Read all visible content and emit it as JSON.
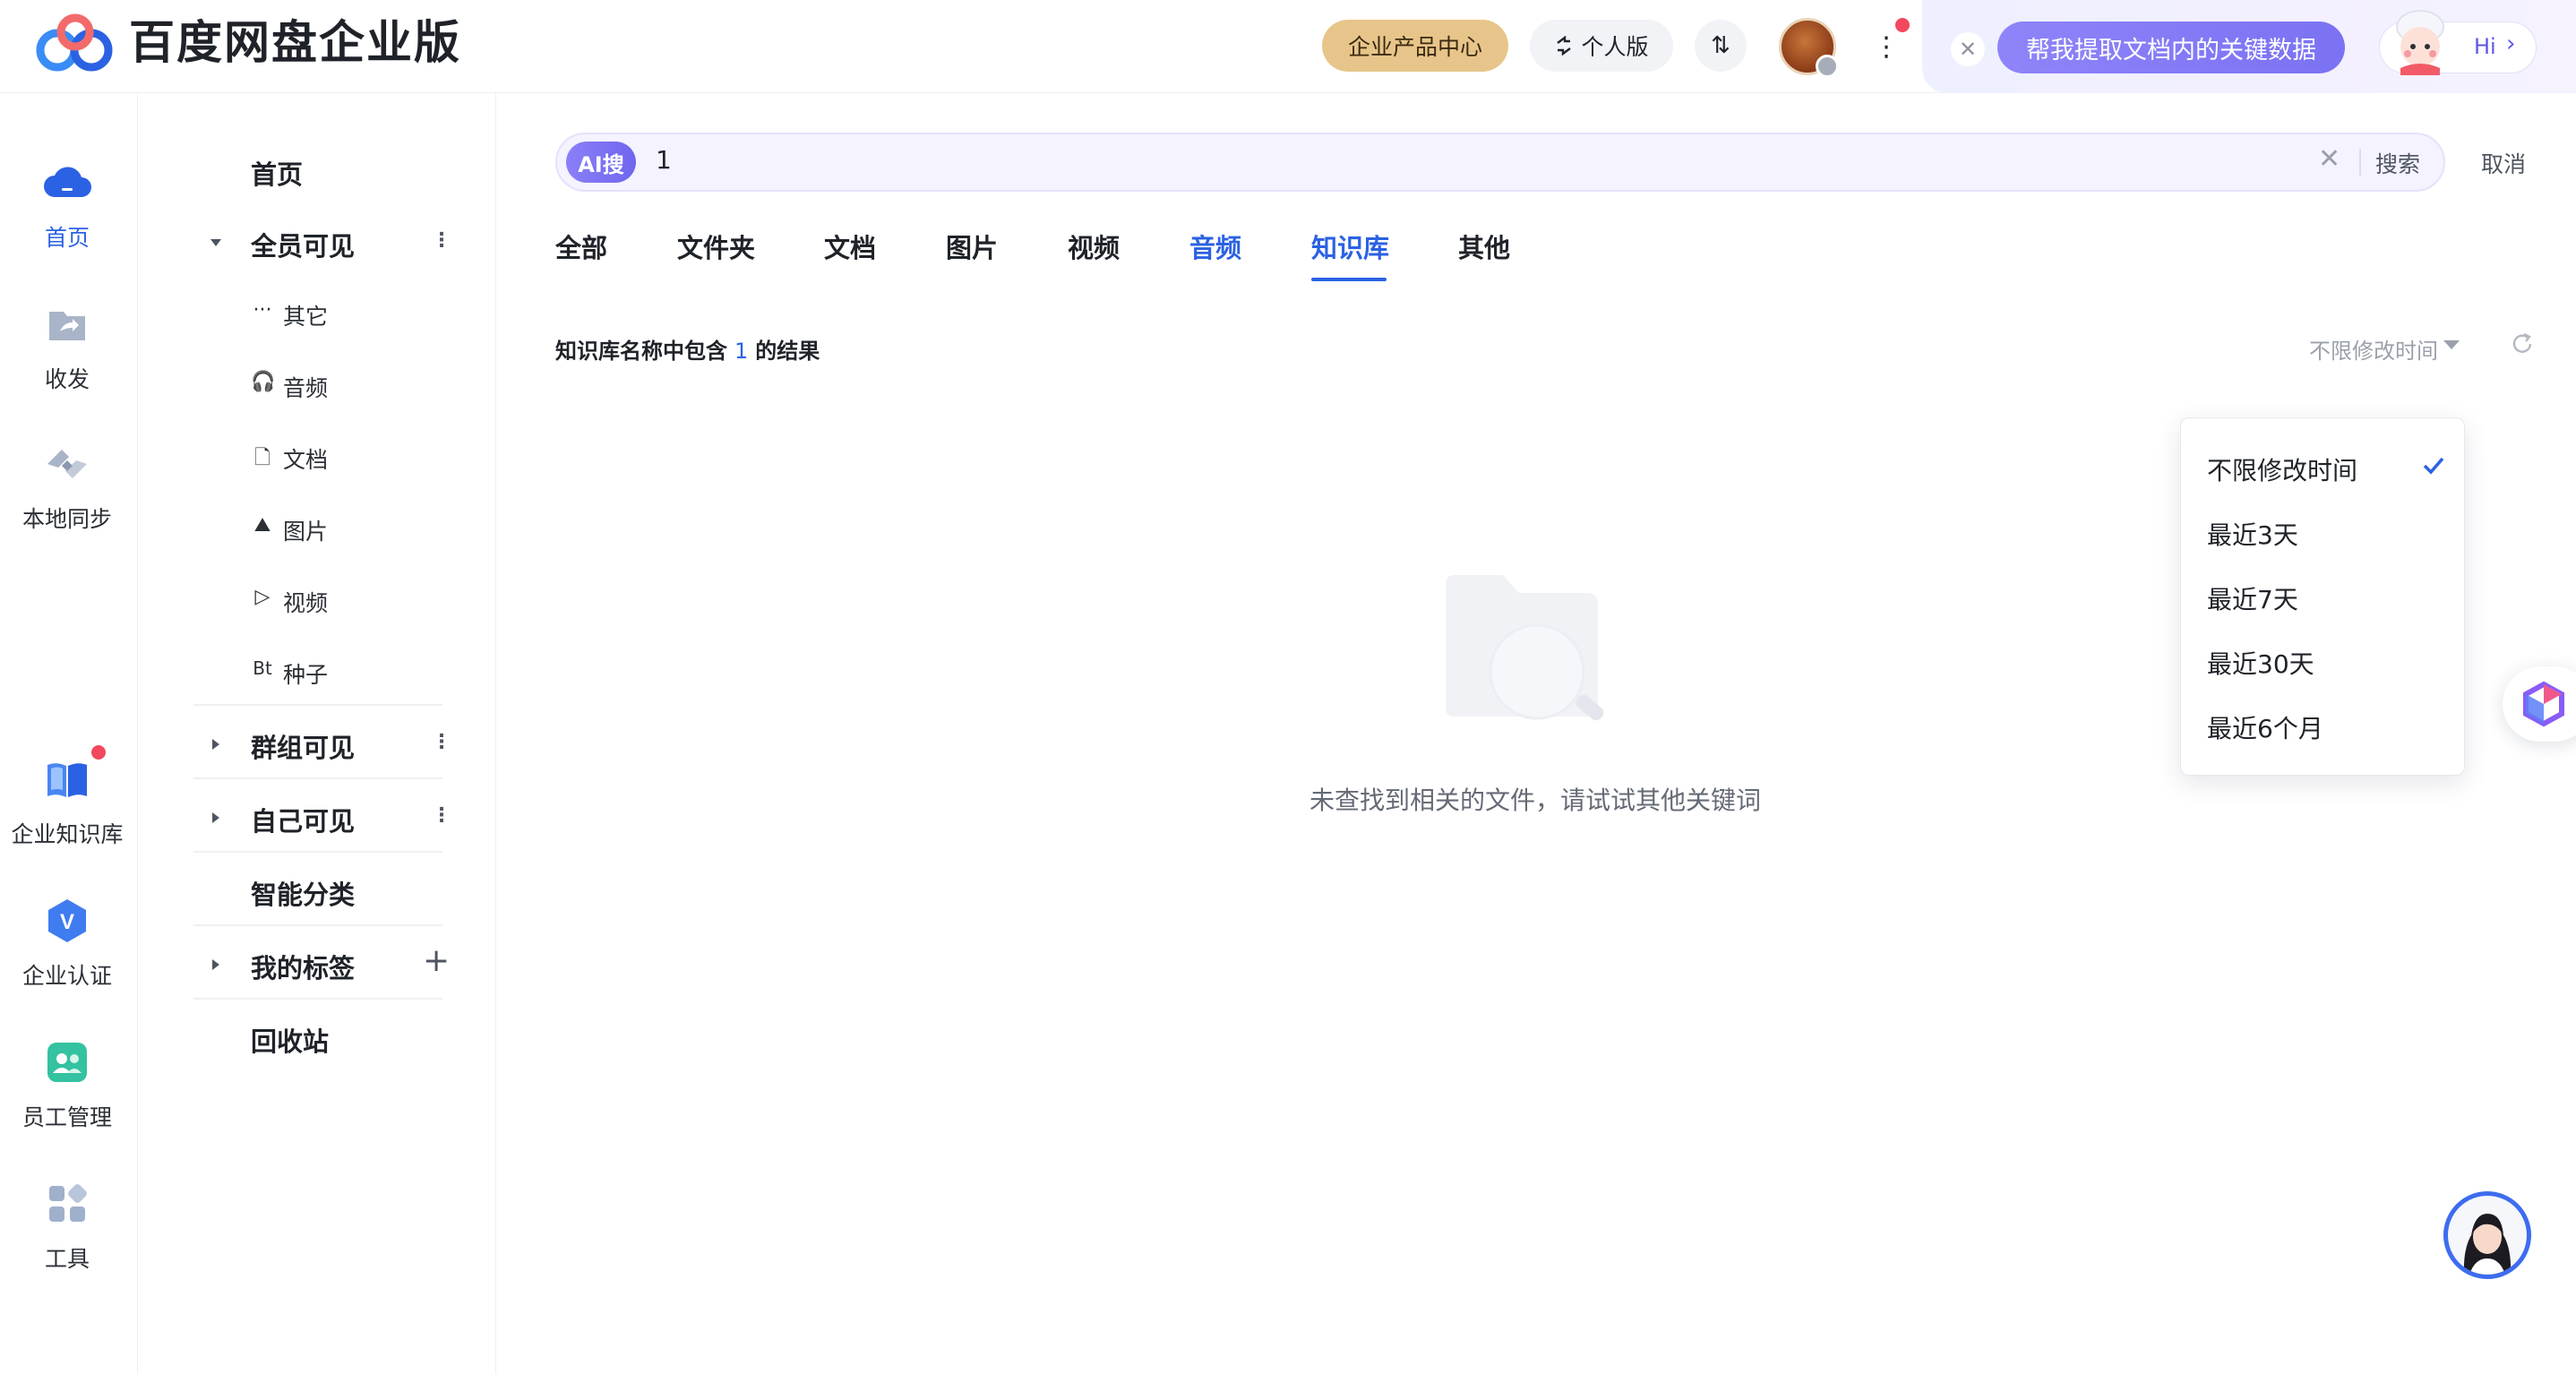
{
  "header": {
    "app_title": "百度网盘企业版",
    "product_center": "企业产品中心",
    "personal_edition": "个人版",
    "transfer_symbol": "⇅",
    "more_symbol": "⋮",
    "ai_prompt": "帮我提取文档内的关键数据",
    "ai_hi": "Hi",
    "ai_hi_chevron": "›",
    "close_symbol": "✕"
  },
  "rail": {
    "items": [
      {
        "label": "首页",
        "icon": "cloud-icon"
      },
      {
        "label": "收发",
        "icon": "share-folder-icon"
      },
      {
        "label": "本地同步",
        "icon": "sync-icon"
      },
      {
        "label": "企业知识库",
        "icon": "book-icon"
      },
      {
        "label": "企业认证",
        "icon": "verified-v-icon"
      },
      {
        "label": "员工管理",
        "icon": "staff-icon"
      },
      {
        "label": "工具",
        "icon": "tools-grid-icon"
      }
    ],
    "verify_letter": "V"
  },
  "sidebar": {
    "home": "首页",
    "all_visible": "全员可见",
    "subs": [
      {
        "label": "其它",
        "icon": "···"
      },
      {
        "label": "音频",
        "icon": "🎧"
      },
      {
        "label": "文档",
        "icon": "🗋"
      },
      {
        "label": "图片",
        "icon": "⛰"
      },
      {
        "label": "视频",
        "icon": "▷"
      },
      {
        "label": "种子",
        "icon": "Bt"
      }
    ],
    "group_visible": "群组可见",
    "self_visible": "自己可见",
    "smart_category": "智能分类",
    "my_tags": "我的标签",
    "recycle": "回收站",
    "kebab": "⋮",
    "plus": "+"
  },
  "search": {
    "ai_badge": "AI搜",
    "query": "1",
    "clear": "✕",
    "search_label": "搜索",
    "cancel_label": "取消"
  },
  "tabs": [
    {
      "label": "全部"
    },
    {
      "label": "文件夹"
    },
    {
      "label": "文档"
    },
    {
      "label": "图片"
    },
    {
      "label": "视频"
    },
    {
      "label": "音频"
    },
    {
      "label": "知识库",
      "active": true
    },
    {
      "label": "其他"
    }
  ],
  "result": {
    "prefix": "知识库名称中包含",
    "keyword": "1",
    "suffix": "的结果",
    "time_filter": "不限修改时间",
    "empty_text": "未查找到相关的文件，请试试其他关键词"
  },
  "dropdown": {
    "options": [
      "不限修改时间",
      "最近3天",
      "最近7天",
      "最近30天",
      "最近6个月"
    ],
    "selected": "不限修改时间"
  },
  "colors": {
    "accent": "#2b62e3",
    "ai_purple": "#7b72f3",
    "gold": "#e7c58a",
    "alert_red": "#f2485d"
  }
}
